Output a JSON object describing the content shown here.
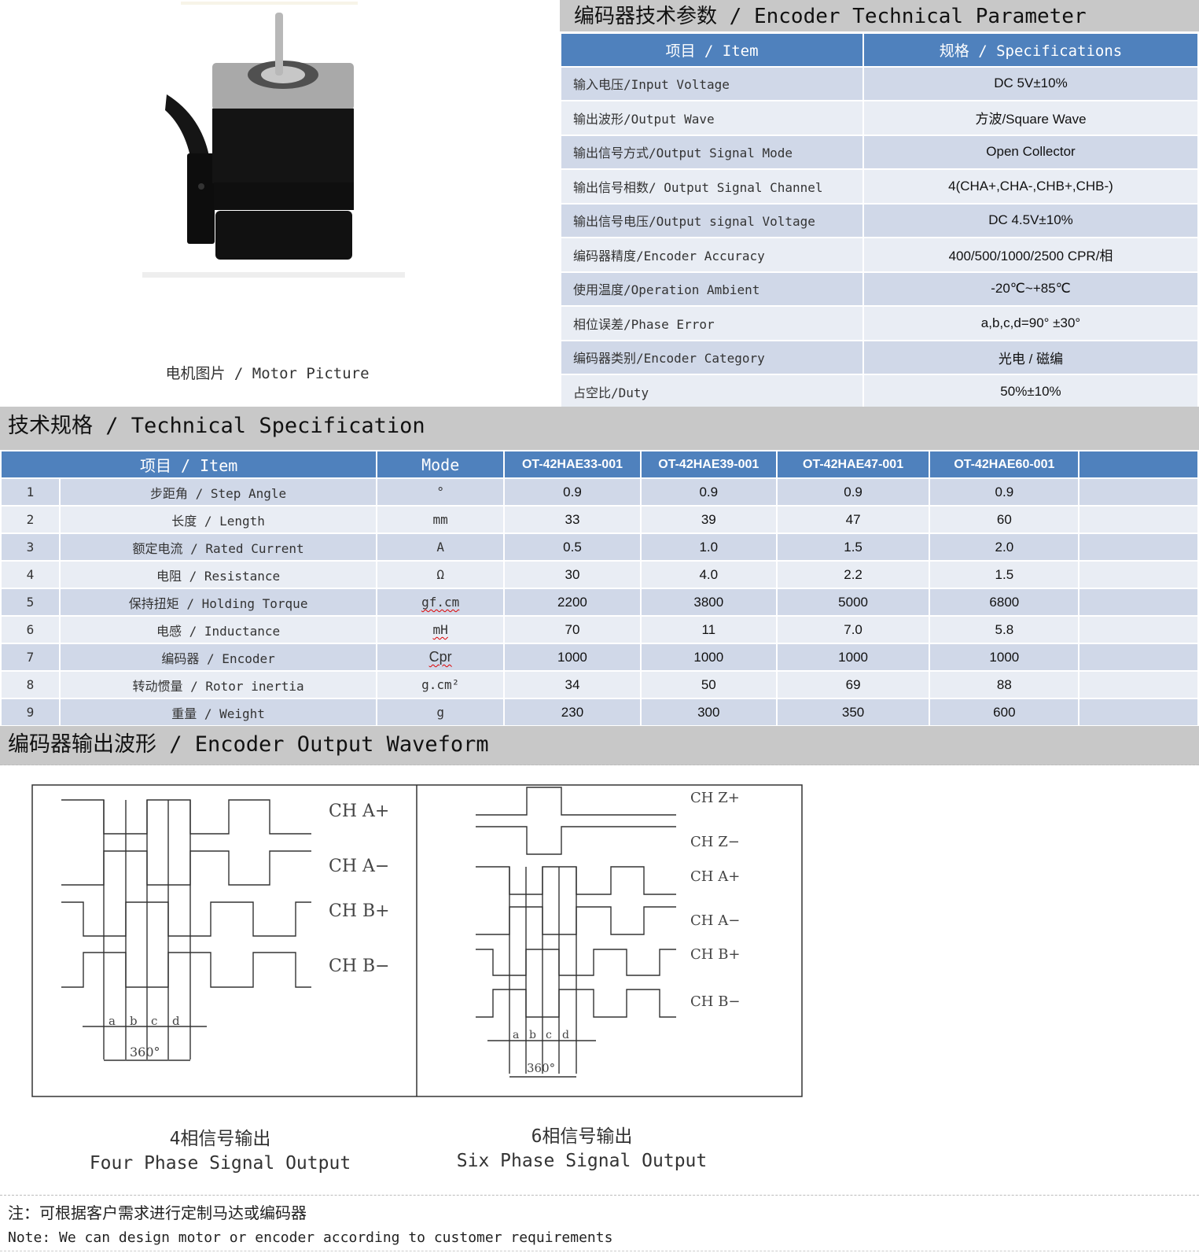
{
  "motor": {
    "caption": "电机图片 / Motor Picture",
    "image_alt": "Stepper motor with encoder"
  },
  "encoder_params": {
    "title": "编码器技术参数 / Encoder Technical Parameter",
    "headers": [
      "项目 / Item",
      "规格 / Specifications"
    ],
    "rows": [
      {
        "item": "输入电压/Input Voltage",
        "spec": "DC 5V±10%"
      },
      {
        "item": "输出波形/Output Wave",
        "spec": "方波/Square Wave"
      },
      {
        "item": "输出信号方式/Output Signal Mode",
        "spec": "Open Collector"
      },
      {
        "item": "输出信号相数/ Output Signal Channel",
        "spec": "4(CHA+,CHA-,CHB+,CHB-)"
      },
      {
        "item": "输出信号电压/Output signal Voltage",
        "spec": "DC 4.5V±10%"
      },
      {
        "item": "编码器精度/Encoder Accuracy",
        "spec": "400/500/1000/2500 CPR/相"
      },
      {
        "item": "使用温度/Operation Ambient",
        "spec": "-20℃~+85℃"
      },
      {
        "item": "相位误差/Phase Error",
        "spec": "a,b,c,d=90° ±30°"
      },
      {
        "item": "编码器类别/Encoder Category",
        "spec": "光电 / 磁编"
      },
      {
        "item": "占空比/Duty",
        "spec": "50%±10%"
      }
    ]
  },
  "tech_spec": {
    "title": "技术规格 / Technical Specification",
    "headers": {
      "item": "项目 / Item",
      "mode": "Mode",
      "models": [
        "OT-42HAE33-001",
        "OT-42HAE39-001",
        "OT-42HAE47-001",
        "OT-42HAE60-001",
        ""
      ]
    },
    "rows": [
      {
        "no": "1",
        "item": "步距角 / Step Angle",
        "unit": "°",
        "values": [
          "0.9",
          "0.9",
          "0.9",
          "0.9",
          ""
        ]
      },
      {
        "no": "2",
        "item": "长度 / Length",
        "unit": "mm",
        "values": [
          "33",
          "39",
          "47",
          "60",
          ""
        ]
      },
      {
        "no": "3",
        "item": "额定电流 / Rated Current",
        "unit": "A",
        "values": [
          "0.5",
          "1.0",
          "1.5",
          "2.0",
          ""
        ]
      },
      {
        "no": "4",
        "item": "电阻 / Resistance",
        "unit": "Ω",
        "values": [
          "30",
          "4.0",
          "2.2",
          "1.5",
          ""
        ]
      },
      {
        "no": "5",
        "item": "保持扭矩 / Holding Torque",
        "unit": "gf.cm",
        "values": [
          "2200",
          "3800",
          "5000",
          "6800",
          ""
        ]
      },
      {
        "no": "6",
        "item": "电感 / Inductance",
        "unit": "mH",
        "values": [
          "70",
          "11",
          "7.0",
          "5.8",
          ""
        ]
      },
      {
        "no": "7",
        "item": "编码器 / Encoder",
        "unit": "Cpr",
        "values": [
          "1000",
          "1000",
          "1000",
          "1000",
          ""
        ]
      },
      {
        "no": "8",
        "item": "转动惯量 / Rotor inertia",
        "unit": "g.cm²",
        "values": [
          "34",
          "50",
          "69",
          "88",
          ""
        ]
      },
      {
        "no": "9",
        "item": "重量 / Weight",
        "unit": "g",
        "values": [
          "230",
          "300",
          "350",
          "600",
          ""
        ]
      }
    ]
  },
  "waveform": {
    "title": "编码器输出波形 / Encoder Output Waveform",
    "four_phase": {
      "labels": [
        "CH A+",
        "CH A−",
        "CH B+",
        "CH B−"
      ],
      "interval_labels": [
        "a",
        "b",
        "c",
        "d"
      ],
      "period_label": "360°",
      "caption_zh": "4相信号输出",
      "caption_en": "Four Phase Signal Output"
    },
    "six_phase": {
      "labels": [
        "CH Z+",
        "CH Z−",
        "CH A+",
        "CH A−",
        "CH B+",
        "CH B−"
      ],
      "interval_labels": [
        "a",
        "b",
        "c",
        "d"
      ],
      "period_label": "360°",
      "caption_zh": "6相信号输出",
      "caption_en": "Six Phase Signal Output"
    }
  },
  "note": {
    "zh": "注：可根据客户需求进行定制马达或编码器",
    "en": "Note: We can design motor or encoder according to customer requirements"
  }
}
